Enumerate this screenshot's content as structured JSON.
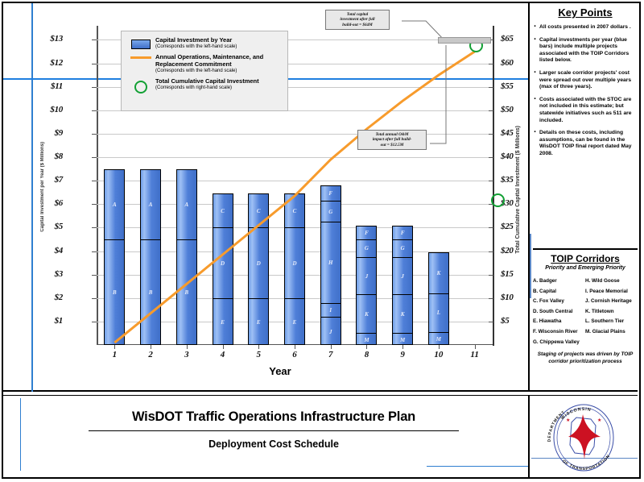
{
  "title_block": {
    "main": "WisDOT Traffic Operations Infrastructure Plan",
    "sub": "Deployment Cost Schedule"
  },
  "seal": {
    "top_text": "WISCONSIN",
    "left_text": "DEPARTMENT",
    "right_text": "TRANSPORTATION",
    "bottom_text": "OF",
    "color": "#cc1122"
  },
  "legend": {
    "items": [
      {
        "key": "bar-swatch",
        "title": "Capital Investment by Year",
        "note": "(Corresponds with the left-hand scale)"
      },
      {
        "key": "orange-line",
        "title": "Annual Operations, Maintenance, and Replacement Commitment",
        "note": "(Corresponds with the left-hand  scale)"
      },
      {
        "key": "green-circle",
        "title": "Total Cumulative Capital Investment",
        "note": "(Corresponds with right-hand scale)"
      }
    ]
  },
  "callouts": [
    {
      "id": "capital-callout",
      "lines": [
        "Total capital",
        "investment after full",
        "build-out = $64M"
      ]
    },
    {
      "id": "om-callout",
      "lines": [
        "Total annual O&M",
        "impact after full build-",
        "out = $12.5M"
      ]
    }
  ],
  "key_points": {
    "title": "Key Points",
    "items": [
      "All costs presented in 2007 dollars .",
      "Capital investments per year (blue bars) include multiple projects  associated with the TOIP Corridors listed below.",
      "Larger scale corridor projects' cost were spread out over multiple years (max of three years).",
      "Costs  associated with the STOC are not included in this estimate;  but statewide initiatives  such as 511 are included.",
      "Details on these costs, including assumptions, can be found in the WisDOT TOIP final report dated May 2008."
    ]
  },
  "toip": {
    "title": "TOIP Corridors",
    "subtitle": "Priority and Emerging Priority",
    "left_column": [
      "A. Badger",
      "B. Capital",
      "C. Fox Valley",
      "D. South Central",
      "E. Hiawatha",
      "F. Wisconsin River",
      "G. Chippewa Valley"
    ],
    "right_column": [
      "H.  Wild Goose",
      "I.  Peace Memorial",
      "J. Cornish Heritage",
      "K. Titletown",
      "L. Southern Tier",
      "M. Glacial Plains"
    ],
    "footnote": "Staging of projects was driven by TOIP corridor prioritization process"
  },
  "chart_data": {
    "type": "bar",
    "title": "",
    "xlabel": "Year",
    "ylabel_left": "Capital Investment per Year ($ Millions)",
    "ylabel_right": "Total Cumulative Capital Investment ($ Millions)",
    "grid": true,
    "legend_position": "upper-left-inside",
    "categories": [
      "1",
      "2",
      "3",
      "4",
      "5",
      "6",
      "7",
      "8",
      "9",
      "10",
      "11"
    ],
    "x_tick_labels": [
      "1",
      "2",
      "3",
      "4",
      "5",
      "6",
      "7",
      "8",
      "9",
      "10",
      "11"
    ],
    "y_left_ticks": [
      "$1",
      "$2",
      "$3",
      "$4",
      "$5",
      "$6",
      "$7",
      "$8",
      "$9",
      "$10",
      "$11",
      "$12",
      "$13"
    ],
    "y_left_values": [
      1,
      2,
      3,
      4,
      5,
      6,
      7,
      8,
      9,
      10,
      11,
      12,
      13
    ],
    "ylim_left": [
      0,
      13.6
    ],
    "y_right_ticks": [
      "$5",
      "$10",
      "$15",
      "$20",
      "$25",
      "$30",
      "$35",
      "$40",
      "$45",
      "$50",
      "$55",
      "$60",
      "$65"
    ],
    "y_right_values": [
      5,
      10,
      15,
      20,
      25,
      30,
      35,
      40,
      45,
      50,
      55,
      60,
      65
    ],
    "ylim_right": [
      0,
      68
    ],
    "bar_color": "#4f7fd8",
    "line_color": "#f79b2c",
    "marker_color": "#12a034",
    "stacked_bars": [
      {
        "year": "1",
        "total": 7.5,
        "segments": [
          {
            "label": "A",
            "value": 3.0
          },
          {
            "label": "B",
            "value": 4.5
          }
        ]
      },
      {
        "year": "2",
        "total": 7.5,
        "segments": [
          {
            "label": "A",
            "value": 3.0
          },
          {
            "label": "B",
            "value": 4.5
          }
        ]
      },
      {
        "year": "3",
        "total": 7.5,
        "segments": [
          {
            "label": "A",
            "value": 3.0
          },
          {
            "label": "B",
            "value": 4.5
          }
        ]
      },
      {
        "year": "4",
        "total": 6.45,
        "segments": [
          {
            "label": "C",
            "value": 1.45
          },
          {
            "label": "D",
            "value": 3.0
          },
          {
            "label": "E",
            "value": 2.0
          }
        ]
      },
      {
        "year": "5",
        "total": 6.45,
        "segments": [
          {
            "label": "C",
            "value": 1.45
          },
          {
            "label": "D",
            "value": 3.0
          },
          {
            "label": "E",
            "value": 2.0
          }
        ]
      },
      {
        "year": "6",
        "total": 6.45,
        "segments": [
          {
            "label": "C",
            "value": 1.45
          },
          {
            "label": "D",
            "value": 3.0
          },
          {
            "label": "E",
            "value": 2.0
          }
        ]
      },
      {
        "year": "7",
        "total": 6.8,
        "segments": [
          {
            "label": "F",
            "value": 0.65
          },
          {
            "label": "G",
            "value": 0.9
          },
          {
            "label": "H",
            "value": 3.45
          },
          {
            "label": "I",
            "value": 0.6
          },
          {
            "label": "J",
            "value": 1.2
          }
        ]
      },
      {
        "year": "8",
        "total": 5.1,
        "segments": [
          {
            "label": "F",
            "value": 0.6
          },
          {
            "label": "G",
            "value": 0.75
          },
          {
            "label": "J",
            "value": 1.6
          },
          {
            "label": "K",
            "value": 1.65
          },
          {
            "label": "M",
            "value": 0.5
          }
        ]
      },
      {
        "year": "9",
        "total": 5.1,
        "segments": [
          {
            "label": "F",
            "value": 0.6
          },
          {
            "label": "G",
            "value": 0.75
          },
          {
            "label": "J",
            "value": 1.6
          },
          {
            "label": "K",
            "value": 1.65
          },
          {
            "label": "M",
            "value": 0.5
          }
        ]
      },
      {
        "year": "10",
        "total": 3.95,
        "segments": [
          {
            "label": "K",
            "value": 1.75
          },
          {
            "label": "L",
            "value": 1.65
          },
          {
            "label": "M",
            "value": 0.55
          }
        ]
      },
      {
        "year": "11",
        "total": 0,
        "segments": []
      }
    ],
    "om_line_left_scale": [
      {
        "x": "1",
        "y": 0.1
      },
      {
        "x": "2",
        "y": 1.35
      },
      {
        "x": "3",
        "y": 2.6
      },
      {
        "x": "4",
        "y": 3.85
      },
      {
        "x": "5",
        "y": 5.1
      },
      {
        "x": "6",
        "y": 6.35
      },
      {
        "x": "7",
        "y": 7.9
      },
      {
        "x": "8",
        "y": 9.2
      },
      {
        "x": "9",
        "y": 10.4
      },
      {
        "x": "10",
        "y": 11.5
      },
      {
        "x": "11",
        "y": 12.5
      }
    ],
    "cumulative_markers_right_scale": [
      {
        "x": "11",
        "y": 64
      }
    ]
  }
}
